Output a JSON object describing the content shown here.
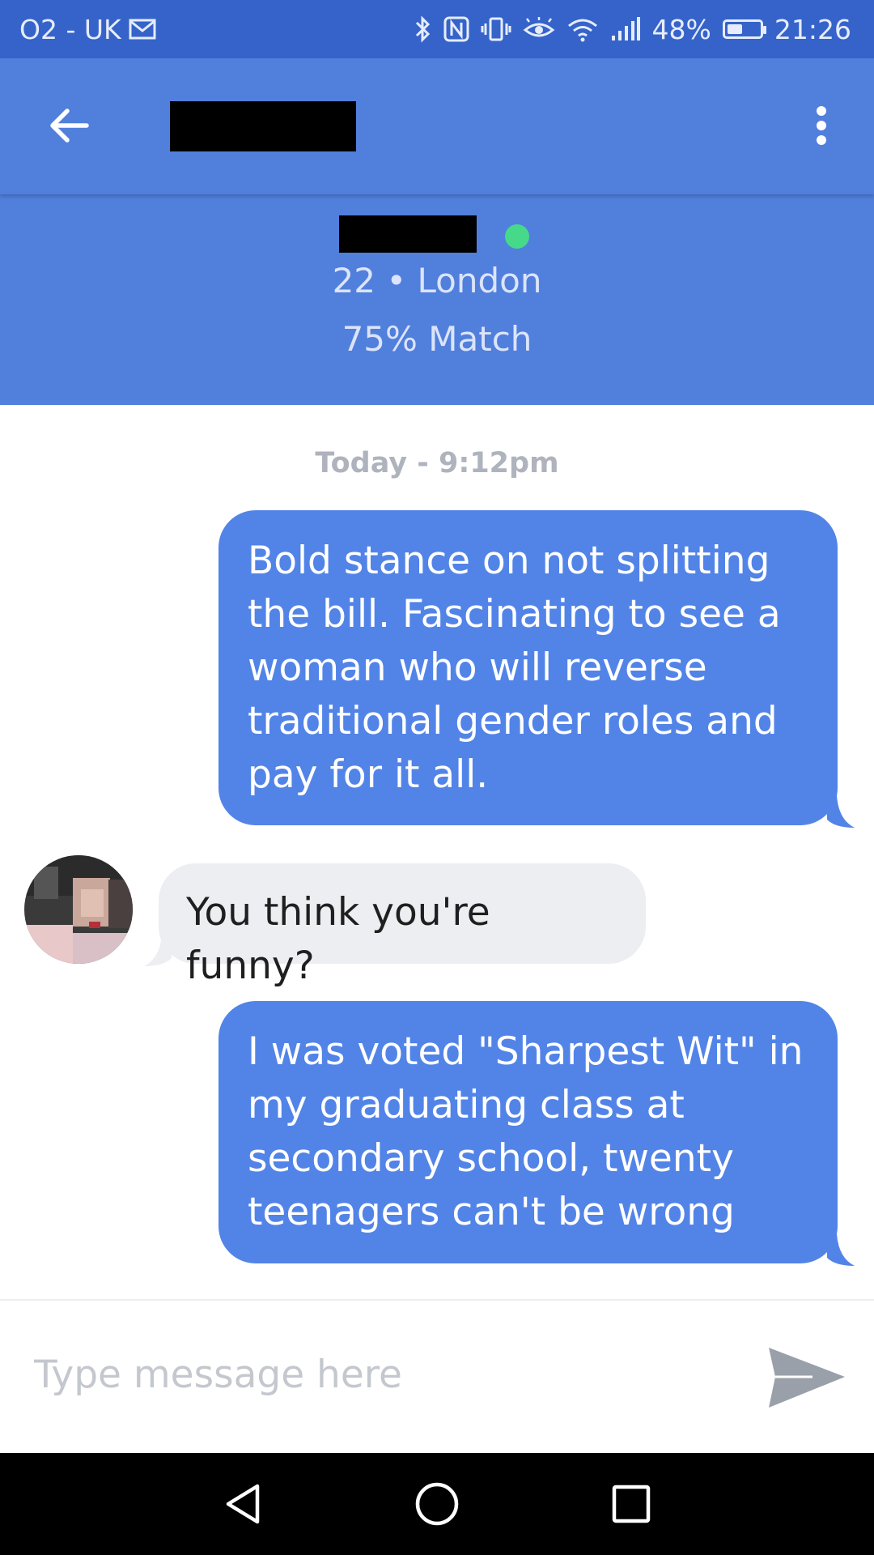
{
  "status_bar": {
    "carrier": "O2 - UK",
    "battery": "48%",
    "battery_level": 0.48,
    "time": "21:26",
    "icons": [
      "mail-icon",
      "bluetooth-icon",
      "nfc-icon",
      "vibrate-icon",
      "eye-comfort-icon",
      "wifi-icon",
      "signal-icon",
      "battery-icon"
    ]
  },
  "header": {
    "back_icon": "back-arrow-icon",
    "menu_icon": "more-vertical-icon"
  },
  "profile": {
    "age_location": "22 • London",
    "match": "75% Match",
    "online_color": "#46d98a"
  },
  "conversation": {
    "date_stamp": "Today - 9:12pm",
    "messages": [
      {
        "direction": "outgoing",
        "text": "Bold stance on not splitting the bill. Fascinating to see a woman who will reverse traditional gender roles and pay for it all."
      },
      {
        "direction": "incoming",
        "text": "You think you're funny?"
      },
      {
        "direction": "outgoing",
        "text": "I was voted \"Sharpest Wit\" in my graduating class at secondary school, twenty teenagers can't be wrong"
      }
    ]
  },
  "composer": {
    "placeholder": "Type message here",
    "value": "",
    "send_icon": "send-icon"
  },
  "nav_bar": {
    "icons": [
      "nav-back-icon",
      "nav-home-icon",
      "nav-recents-icon"
    ]
  },
  "colors": {
    "status_bar": "#3563c9",
    "header": "#517fdc",
    "outgoing_bubble": "#5284e8",
    "incoming_bubble": "#eceef2"
  }
}
